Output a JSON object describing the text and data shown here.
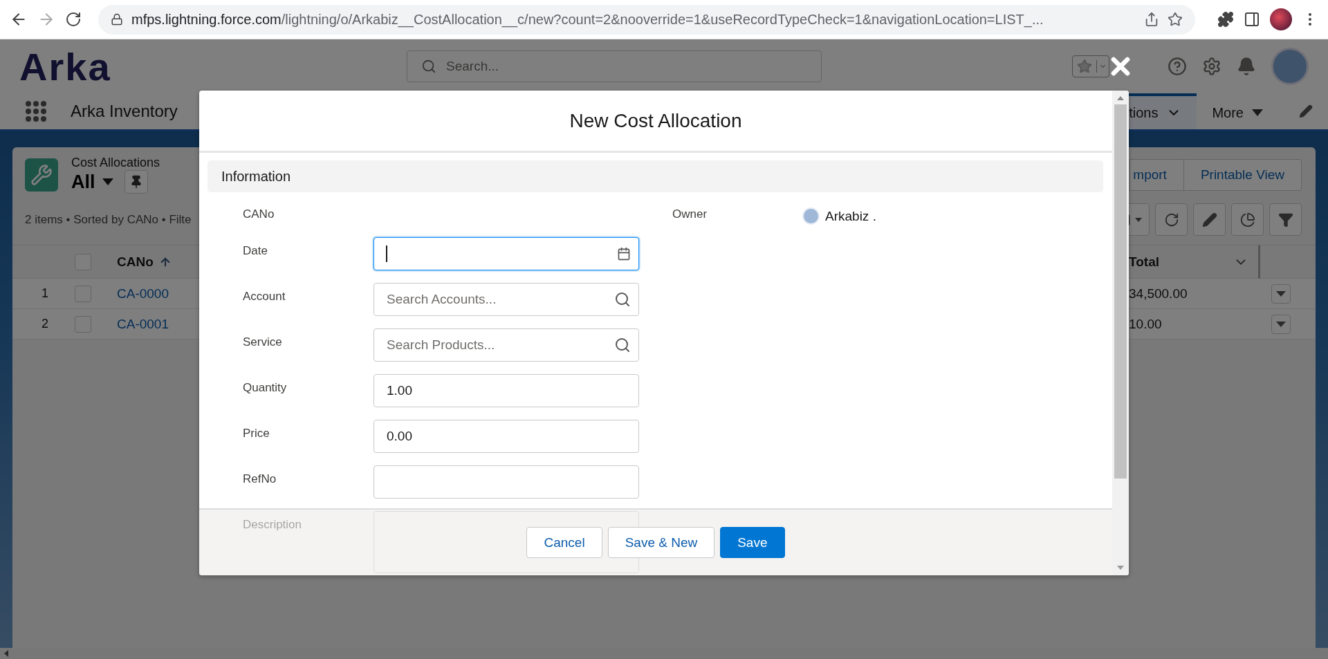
{
  "browser": {
    "url_host": "mfps.lightning.force.com",
    "url_path": "/lightning/o/Arkabiz__CostAllocation__c/new?count=2&nooverride=1&useRecordTypeCheck=1&navigationLocation=LIST_..."
  },
  "header": {
    "logo": "Arka",
    "search_placeholder": "Search..."
  },
  "nav": {
    "app_name": "Arka Inventory",
    "tabs": [
      {
        "label": "tions",
        "selected": true
      },
      {
        "label": "More",
        "selected": false
      }
    ]
  },
  "list": {
    "all_selected": false,
    "object_label": "Cost Allocations",
    "view_name": "All",
    "status": "2 items • Sorted by CANo • Filte",
    "buttons": [
      "mport",
      "Printable View"
    ],
    "columns": [
      {
        "label": "CANo",
        "sorted": true
      },
      {
        "label": "Total",
        "sorted": false
      }
    ],
    "rows": [
      {
        "number": "1",
        "name": "CA-0000",
        "total": "34,500.00",
        "selected": false
      },
      {
        "number": "2",
        "name": "CA-0001",
        "total": "10.00",
        "selected": false
      }
    ]
  },
  "modal": {
    "title": "New Cost Allocation",
    "section": "Information",
    "fields": [
      {
        "label": "CANo",
        "kind": "readonly"
      },
      {
        "label": "Date",
        "kind": "date",
        "focused": true
      },
      {
        "label": "Account",
        "kind": "lookup",
        "placeholder": "Search Accounts...",
        "focused": false
      },
      {
        "label": "Service",
        "kind": "lookup",
        "placeholder": "Search Products...",
        "focused": false
      },
      {
        "label": "Quantity",
        "kind": "text",
        "value": "1.00",
        "focused": false
      },
      {
        "label": "Price",
        "kind": "text",
        "value": "0.00",
        "focused": false
      },
      {
        "label": "RefNo",
        "kind": "text",
        "focused": false
      },
      {
        "label": "Description",
        "kind": "textarea",
        "focused": false
      }
    ],
    "owner": {
      "label": "Owner",
      "value": "Arkabiz ."
    },
    "buttons": [
      {
        "label": "Cancel",
        "kind": "neutral"
      },
      {
        "label": "Save & New",
        "kind": "neutral"
      },
      {
        "label": "Save",
        "kind": "brand"
      }
    ]
  }
}
